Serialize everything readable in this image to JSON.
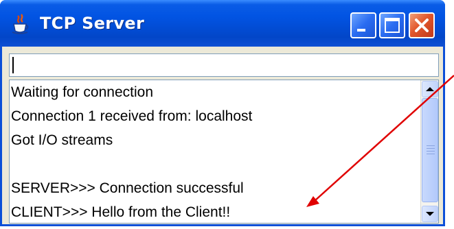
{
  "window": {
    "title": "TCP Server",
    "title_bar_color": "#0254e3",
    "controls": [
      "minimize-icon",
      "maximize-icon",
      "close-icon"
    ]
  },
  "input": {
    "value": ""
  },
  "output": {
    "lines": [
      "Waiting for connection",
      "Connection 1 received from: localhost",
      "Got I/O streams",
      "",
      "SERVER>>> Connection successful",
      "CLIENT>>> Hello from the Client!!"
    ]
  },
  "annotation": {
    "arrow_color": "#e00000",
    "points_to": "CLIENT>>> Hello from the Client!!"
  }
}
